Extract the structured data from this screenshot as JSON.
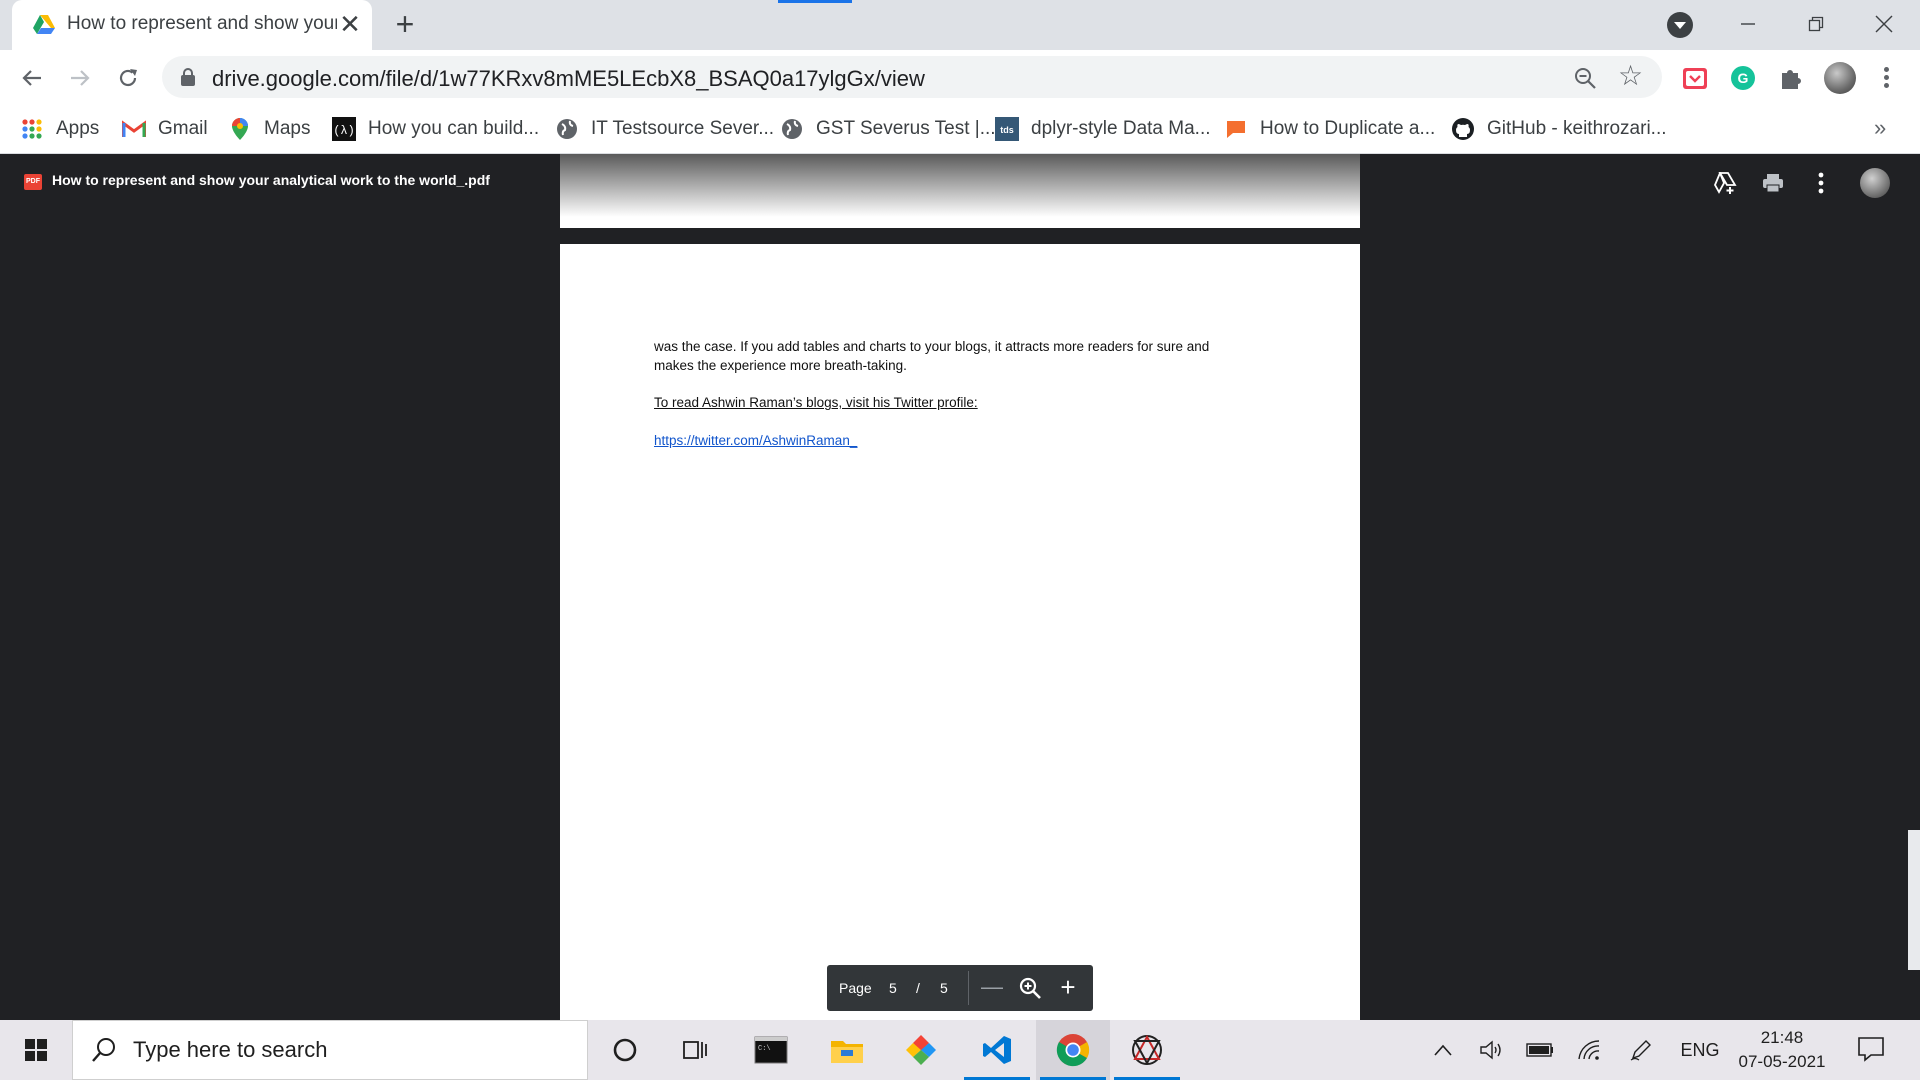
{
  "browser": {
    "tab_title": "How to represent and show your analytical work to the world_.pdf - Google Drive",
    "url": "drive.google.com/file/d/1w77KRxv8mME5LEcbX8_BSAQ0a17ylgGx/view",
    "accent_color": "#1a73e8"
  },
  "bookmarks": [
    {
      "label": "Apps",
      "icon": "apps-grid-icon"
    },
    {
      "label": "Gmail",
      "icon": "gmail-icon"
    },
    {
      "label": "Maps",
      "icon": "maps-pin-icon"
    },
    {
      "label": "How you can build...",
      "icon": "site-logo-icon"
    },
    {
      "label": "IT Testsource Sever...",
      "icon": "globe-icon"
    },
    {
      "label": "GST Severus Test |...",
      "icon": "globe-icon"
    },
    {
      "label": "dplyr-style Data Ma...",
      "icon": "tds-icon"
    },
    {
      "label": "How to Duplicate a...",
      "icon": "chat-bubble-icon"
    },
    {
      "label": "GitHub - keithrozari...",
      "icon": "github-icon"
    }
  ],
  "bookmarks_overflow": "»",
  "viewer": {
    "file_title": "How to represent and show your analytical work to the world_.pdf",
    "pdf_badge": "PDF",
    "page_text": {
      "line1": "was the case. If you add tables and charts to your blogs, it attracts more readers for sure and",
      "line2": "makes the experience more breath-taking.",
      "underlined": "To read Ashwin Raman’s blogs, visit his Twitter profile:",
      "link": "https://twitter.com/AshwinRaman_"
    },
    "pager": {
      "label": "Page",
      "current": "5",
      "separator": "/",
      "total": "5",
      "zoom_out": "—",
      "zoom_in": "+"
    }
  },
  "taskbar": {
    "search_placeholder": "Type here to search",
    "language": "ENG",
    "time": "21:48",
    "date": "07-05-2021"
  }
}
